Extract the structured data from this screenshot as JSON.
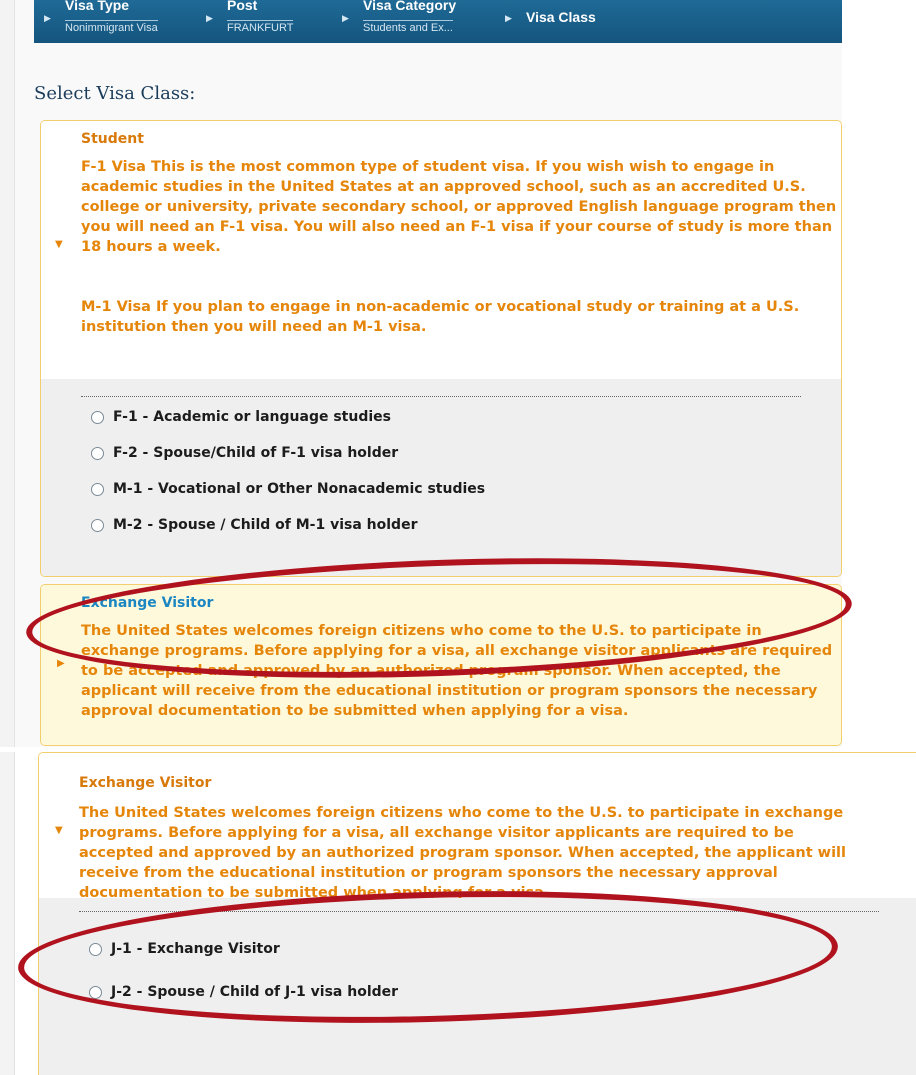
{
  "breadcrumb": {
    "steps": [
      {
        "title": "Visa Type",
        "value": "Nonimmigrant Visa"
      },
      {
        "title": "Post",
        "value": "FRANKFURT"
      },
      {
        "title": "Visa Category",
        "value": "Students and Ex..."
      },
      {
        "title": "Visa Class",
        "value": ""
      }
    ]
  },
  "page_title": "Select Visa Class:",
  "student": {
    "title": "Student",
    "desc_f1": "F-1 Visa This is the most common type of student visa. If you wish wish to engage in academic studies in the United States at an approved school, such as an accredited U.S. college or university, private secondary school, or approved English language program then you will need an F-1 visa. You will also need an F-1 visa if your course of study is more than 18 hours a week.",
    "desc_m1": "M-1 Visa If you plan to engage in non-academic or vocational study or training at a U.S. institution then you will need an M-1 visa.",
    "options": [
      "F-1 - Academic or language studies",
      "F-2 - Spouse/Child of F-1 visa holder",
      "M-1 - Vocational or Other Nonacademic studies",
      "M-2 - Spouse / Child of M-1 visa holder"
    ]
  },
  "exchange": {
    "title": "Exchange Visitor",
    "desc": "The United States welcomes foreign citizens who come to the U.S. to participate in exchange programs. Before applying for a visa, all exchange visitor applicants are required to be accepted and approved by an authorized program sponsor. When accepted, the applicant will receive from the educational institution or program sponsors the necessary approval documentation to be submitted when applying for a visa.",
    "options": [
      "J-1 - Exchange Visitor",
      "J-2 - Spouse / Child of J-1 visa holder"
    ]
  },
  "colors": {
    "nav_bar": "#14557e",
    "accent_orange": "#e5860b",
    "title_blue": "#1b86c1",
    "title_orange": "#d87a0a",
    "annotation_red": "#b0131e",
    "panel_border": "#f2ce6c"
  },
  "icons": [
    "breadcrumb-arrow-icon",
    "caret-down-icon",
    "caret-right-icon",
    "radio-icon"
  ]
}
